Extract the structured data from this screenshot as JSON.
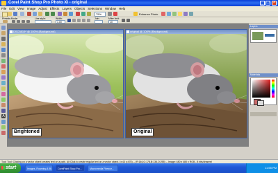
{
  "window": {
    "title": "Corel Paint Shop Pro Photo XI - original"
  },
  "menu": [
    "File",
    "Edit",
    "View",
    "Image",
    "Adjust",
    "Effects",
    "Layers",
    "Objects",
    "Selections",
    "Window",
    "Help"
  ],
  "toolbar1": {
    "enhance_label": "Enhance Photo",
    "pct_value": "75%"
  },
  "toolbar2": {
    "presets_label": "Presets:",
    "mode_label": "Mode:",
    "line_style_label": "Line style:",
    "width_label": "Width:",
    "join_label": "Join:",
    "miter_label": "Miter limit:",
    "width_value": "1.00",
    "miter_value": "10"
  },
  "documents": [
    {
      "title": "DSC5819* @ 100% (Background)",
      "caption": "Brightened"
    },
    {
      "title": "original @ 100% (Background)",
      "caption": "Original"
    }
  ],
  "panels": {
    "layers_title": "Layers",
    "materials_title": "Materials"
  },
  "statusbar": {
    "text": "Tool: Tool: Clicking on a vector object creates text on a path. Alt Click to create regular text on a vector object. (x:43 y:478) -- (R:146,G:178,B:136,O:255) -- Image: 480 x 480 x RGB - 8 bits/channel"
  },
  "taskbar": {
    "start_label": "start",
    "tasks": [
      "Images, Roaming & Bl...",
      "CorelPaint Shop Pro...",
      "Macromedia Firewor..."
    ],
    "clock": "11:55 PM"
  },
  "colors": {
    "titlebar": "#0a3ed8",
    "taskbar": "#1f58d6",
    "start": "#2c8a2c",
    "workspace": "#808080"
  }
}
